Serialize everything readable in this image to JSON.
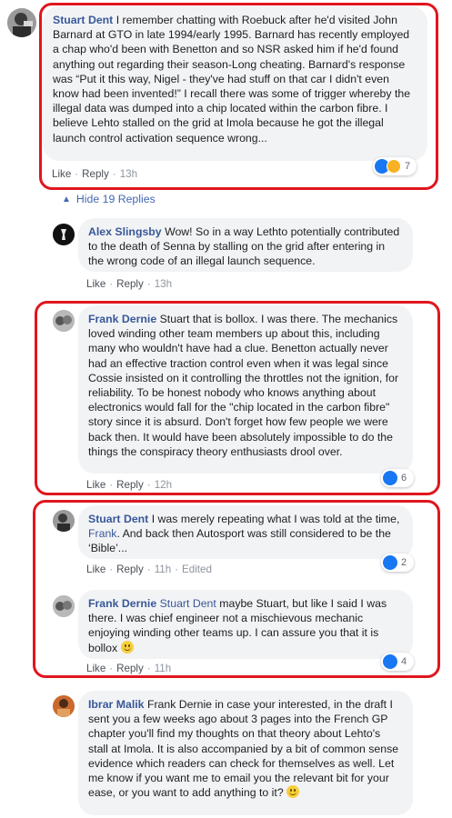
{
  "actions": {
    "like": "Like",
    "reply": "Reply",
    "sep": "·",
    "edited": "Edited"
  },
  "replies_toggle": {
    "label": "Hide 19 Replies"
  },
  "comments": [
    {
      "author": "Stuart Dent",
      "text": "I remember chatting with Roebuck after he'd visited John Barnard at GTO in late 1994/early 1995. Barnard has recently employed a chap who'd been with Benetton and so NSR asked him if he'd found anything out regarding their season-Long cheating. Barnard's response was “Put it this way, Nigel - they've had stuff on that car I didn't even know had been invented!” I recall there was some of trigger whereby the illegal data was dumped into a chip located within the carbon fibre. I believe Lehto stalled on the grid at Imola because he got the illegal launch control activation sequence wrong...",
      "time": "13h",
      "reaction_count": "7"
    },
    {
      "author": "Alex Slingsby",
      "text": "Wow! So in a way Lethto potentially contributed to the death of Senna by stalling on the grid after entering in the wrong code of an illegal launch sequence.",
      "time": "13h"
    },
    {
      "author": "Frank Dernie",
      "text": "Stuart that is bollox. I was there. The mechanics loved winding other team members up about this, including many who wouldn't have had a clue. Benetton actually never had an effective traction control even when it was legal since Cossie insisted on it controlling the throttles not the ignition, for reliability. To be honest nobody who knows anything about electronics would fall for the \"chip located in the carbon fibre\" story since it is absurd. Don't forget how few people we were back then. It would have been absolutely impossible to do the things the conspiracy theory enthusiasts drool over.",
      "time": "12h",
      "reaction_count": "6"
    },
    {
      "author": "Stuart Dent",
      "text_before": "I was merely repeating what I was told at the time,",
      "mention": "Frank",
      "text_after": ". And back then Autosport was still considered to be the ‘Bible’...",
      "time": "11h",
      "reaction_count": "2"
    },
    {
      "author": "Frank Dernie",
      "mention": "Stuart Dent",
      "text": "maybe Stuart, but like I said I was there. I was chief engineer not a mischievous mechanic enjoying winding other teams up. I can assure you that it is bollox",
      "time": "11h",
      "reaction_count": "4"
    },
    {
      "author": "Ibrar Malik",
      "text": "Frank Dernie in case your interested, in the draft I sent you a few weeks ago about 3 pages into the French GP chapter you'll find my thoughts on that theory about Lehto's stall at Imola. It is also accompanied by a bit of common sense evidence which readers can check for themselves as well. Let me know if you want me to email you the relevant bit for your ease, or you want to add anything to it?"
    }
  ]
}
